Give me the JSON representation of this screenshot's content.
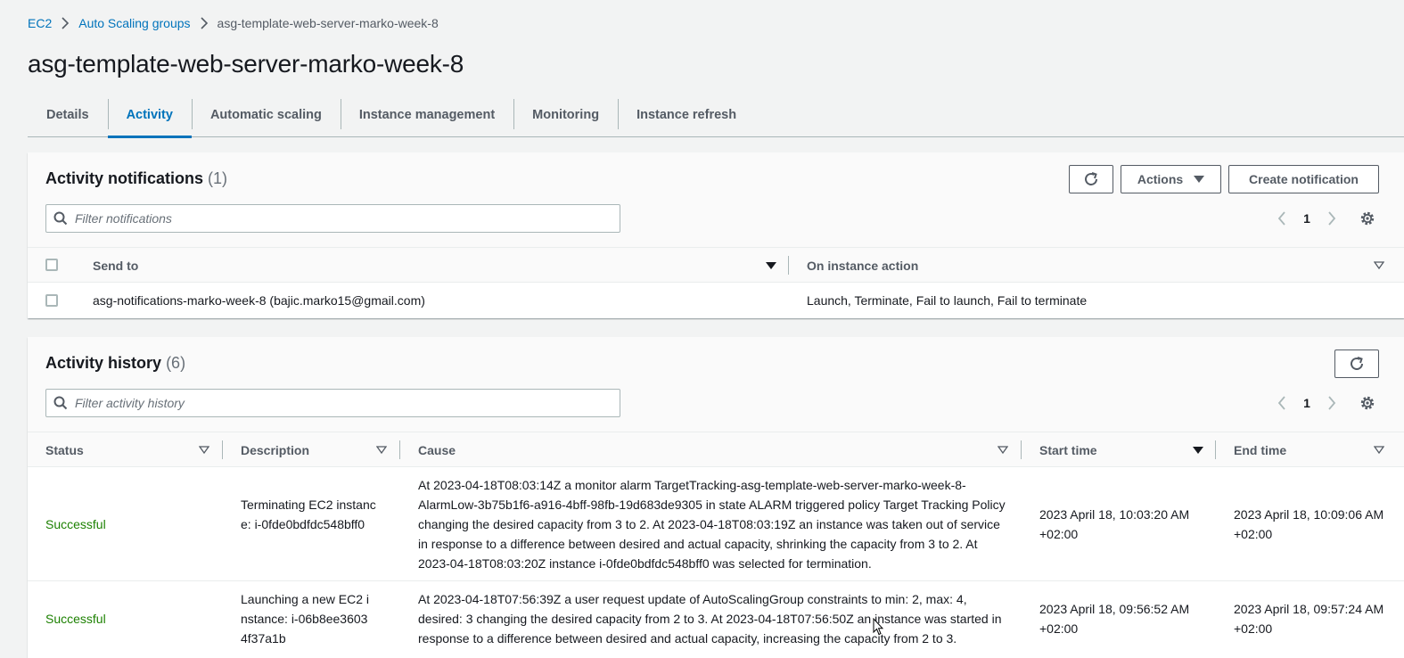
{
  "breadcrumb": {
    "items": [
      "EC2",
      "Auto Scaling groups"
    ],
    "current": "asg-template-web-server-marko-week-8"
  },
  "page": {
    "title": "asg-template-web-server-marko-week-8"
  },
  "tabs": [
    {
      "label": "Details"
    },
    {
      "label": "Activity",
      "active": true
    },
    {
      "label": "Automatic scaling"
    },
    {
      "label": "Instance management"
    },
    {
      "label": "Monitoring"
    },
    {
      "label": "Instance refresh"
    }
  ],
  "notifications": {
    "title": "Activity notifications",
    "count": "(1)",
    "actions_label": "Actions",
    "create_label": "Create notification",
    "filter_placeholder": "Filter notifications",
    "page": "1",
    "columns": [
      "Send to",
      "On instance action"
    ],
    "rows": [
      {
        "send_to": "asg-notifications-marko-week-8 (bajic.marko15@gmail.com)",
        "action": "Launch, Terminate, Fail to launch, Fail to terminate"
      }
    ]
  },
  "history": {
    "title": "Activity history",
    "count": "(6)",
    "filter_placeholder": "Filter activity history",
    "page": "1",
    "columns": [
      "Status",
      "Description",
      "Cause",
      "Start time",
      "End time"
    ],
    "rows": [
      {
        "status": "Successful",
        "description": "Terminating EC2 instance: i-0fde0bdfdc548bff0",
        "cause": "At 2023-04-18T08:03:14Z a monitor alarm TargetTracking-asg-template-web-server-marko-week-8-AlarmLow-3b75b1f6-a916-4bff-98fb-19d683de9305 in state ALARM triggered policy Target Tracking Policy changing the desired capacity from 3 to 2. At 2023-04-18T08:03:19Z an instance was taken out of service in response to a difference between desired and actual capacity, shrinking the capacity from 3 to 2. At 2023-04-18T08:03:20Z instance i-0fde0bdfdc548bff0 was selected for termination.",
        "start": "2023 April 18, 10:03:20 AM +02:00",
        "end": "2023 April 18, 10:09:06 AM +02:00"
      },
      {
        "status": "Successful",
        "description": "Launching a new EC2 instance: i-06b8ee36034f37a1b",
        "cause": "At 2023-04-18T07:56:39Z a user request update of AutoScalingGroup constraints to min: 2, max: 4, desired: 3 changing the desired capacity from 2 to 3. At 2023-04-18T07:56:50Z an instance was started in response to a difference between desired and actual capacity, increasing the capacity from 2 to 3.",
        "start": "2023 April 18, 09:56:52 AM +02:00",
        "end": "2023 April 18, 09:57:24 AM +02:00"
      }
    ]
  }
}
